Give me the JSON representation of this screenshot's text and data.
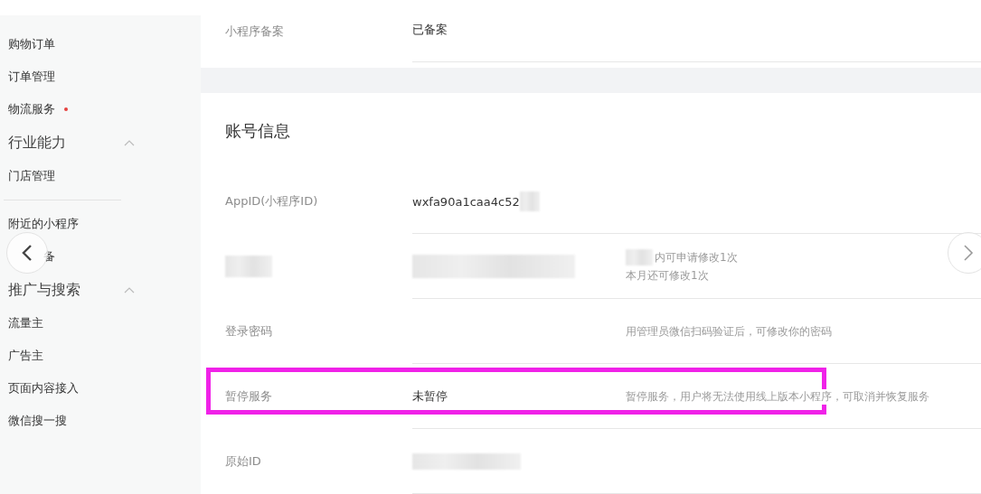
{
  "sidebar": {
    "items": [
      {
        "kind": "item",
        "label": "购物订单"
      },
      {
        "kind": "item",
        "label": "订单管理"
      },
      {
        "kind": "item",
        "label": "物流服务",
        "dot": true
      },
      {
        "kind": "section",
        "label": "行业能力",
        "expanded": true
      },
      {
        "kind": "item",
        "label": "门店管理"
      },
      {
        "kind": "divider"
      },
      {
        "kind": "item",
        "label": "附近的小程序"
      },
      {
        "kind": "item",
        "label": "备"
      },
      {
        "kind": "section",
        "label": "推广与搜索",
        "expanded": true
      },
      {
        "kind": "item",
        "label": "流量主"
      },
      {
        "kind": "item",
        "label": "广告主"
      },
      {
        "kind": "item",
        "label": "页面内容接入"
      },
      {
        "kind": "item",
        "label": "微信搜一搜"
      }
    ]
  },
  "filing": {
    "label": "小程序备案",
    "value": "已备案"
  },
  "account": {
    "title": "账号信息",
    "rows": [
      {
        "label": "AppID(小程序ID)",
        "value": "wxfa90a1caa4c52",
        "value_blurred": true,
        "highlighted": false
      },
      {
        "label_blurred": true,
        "value_blurred": true,
        "hint_blurred": true,
        "hint": [
          "内可申请修改1次",
          "本月还可修改1次"
        ],
        "highlighted": false
      },
      {
        "label": "登录密码",
        "hint": [
          "用管理员微信扫码验证后，可修改你的密码"
        ],
        "highlighted": false
      },
      {
        "label": "暂停服务",
        "value": "未暂停",
        "hint": [
          "暂停服务，用户将无法使用线上版本小程序，可取消并恢复服务"
        ],
        "highlighted": true
      },
      {
        "label": "原始ID",
        "value_blurred": true,
        "highlighted": false
      }
    ]
  }
}
